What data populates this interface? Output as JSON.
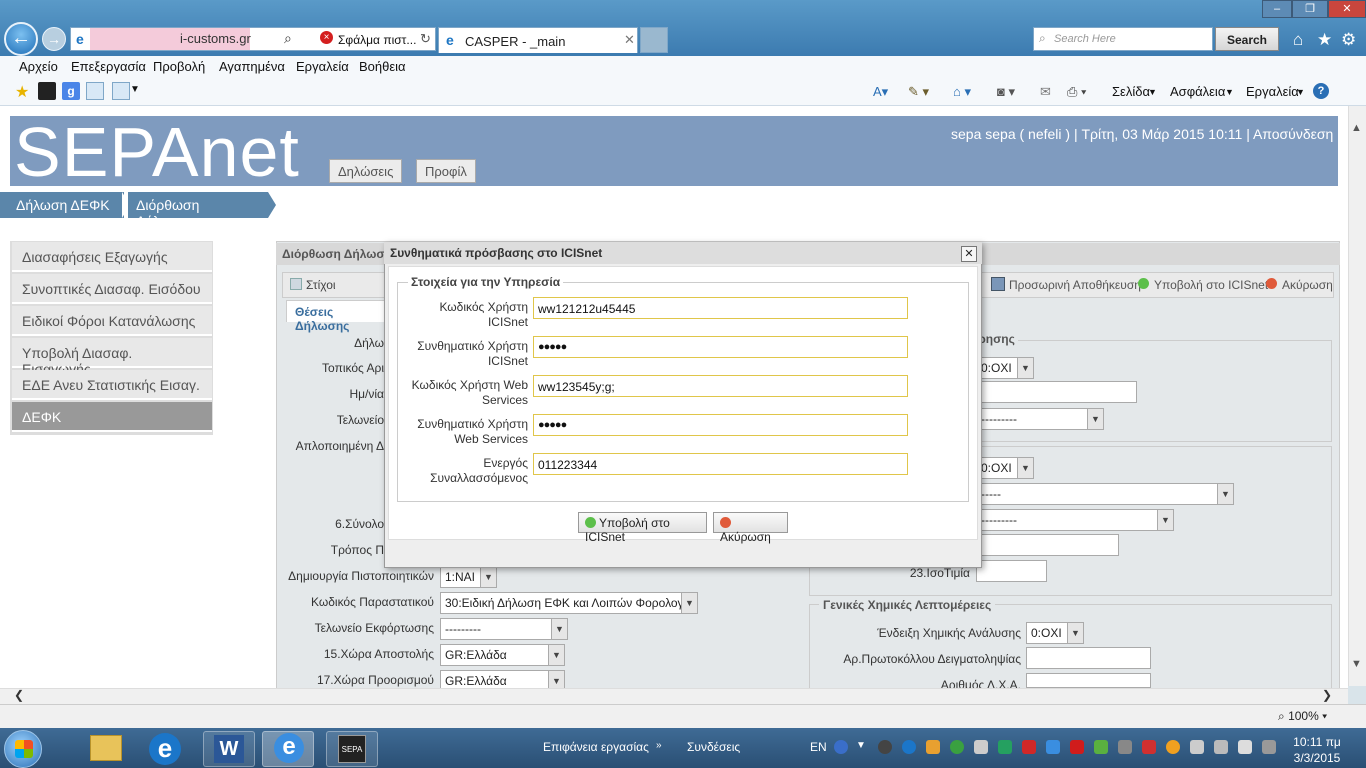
{
  "browser": {
    "address": "i-customs.gr",
    "error_tab": "Σφάλμα πιστ...",
    "tab_title": "CASPER - _main",
    "search_placeholder": "Search Here",
    "search_button": "Search",
    "menu": [
      "Αρχείο",
      "Επεξεργασία",
      "Προβολή",
      "Αγαπημένα",
      "Εργαλεία",
      "Βοήθεια"
    ],
    "toolbar": [
      "Σελίδα",
      "Ασφάλεια",
      "Εργαλεία"
    ],
    "zoom": "100%"
  },
  "app": {
    "logo": "SEPAnet",
    "header_tabs": [
      "Δηλώσεις",
      "Προφίλ"
    ],
    "user_line": "sepa sepa ( nefeli ) | Τρίτη, 03 Μάρ 2015 10:11 | Αποσύνδεση",
    "breadcrumb": [
      "Δήλωση ΔΕΦΚ",
      "Διόρθωση Δήλωσης"
    ],
    "sidebar": [
      "Διασαφήσεις Εξαγωγής",
      "Συνοπτικές Διασαφ. Εισόδου",
      "Ειδικοί Φόροι Κατανάλωσης",
      "Υποβολή Διασαφ. Εισαγωγής",
      "ΕΔΕ Ανευ Στατιστικής Εισαγ.",
      "ΔΕΦΚ"
    ]
  },
  "panel": {
    "title": "Διόρθωση Δήλωσ",
    "tab_stixoi": "Στίχοι",
    "tab_theseis": "Θέσεις Δήλωσης",
    "save_temp": "Προσωρινή Αποθήκευση",
    "submit": "Υποβολή στο ICISnet",
    "cancel": "Ακύρωση",
    "section_right": "όρησης",
    "labels_left": [
      "Δήλω",
      "Τοπικός Αρι",
      "Ημ/νία",
      "Τελωνείο",
      "Απλοποιημένη Δ",
      "6.Σύνολο",
      "Τρόπος Π"
    ],
    "fields": {
      "pistop_label": "Δημιουργία Πιστοποιητικών",
      "pistop_value": "1:ΝΑΙ",
      "parast_label": "Κωδικός Παραστατικού",
      "parast_value": "30:Ειδική Δήλωση ΕΦΚ και Λοιπών Φορολογι",
      "telon_label": "Τελωνείο Εκφόρτωσης",
      "telon_value": "---------",
      "xora_apost_label": "15.Χώρα Αποστολής",
      "xora_apost_value": "GR:Ελλάδα",
      "xora_proor_label": "17.Χώρα Προορισμού",
      "xora_proor_value": "GR:Ελλάδα",
      "r1": "0:ΟΧΙ",
      "r2": "---------",
      "r3": "0:ΟΧΙ",
      "r4": "-----",
      "r5": "---------",
      "r6_label": "23.ΙσοΤιμία"
    },
    "chem": {
      "legend": "Γενικές Χημικές Λεπτομέρειες",
      "analysis_label": "Ένδειξη Χημικής Ανάλυσης",
      "analysis_value": "0:ΟΧΙ",
      "protocol_label": "Αρ.Πρωτοκόλλου Δειγματοληψίας",
      "dxa_label": "Αριθμός Δ.Χ.Α."
    }
  },
  "dialog": {
    "title": "Συνθηματικά πρόσβασης στο ICISnet",
    "legend": "Στοιχεία για την Υπηρεσία",
    "rows": [
      {
        "label": "Κωδικός Χρήστη ICISnet",
        "value": "ww121212u45445"
      },
      {
        "label": "Συνθηματικό Χρήστη ICISnet",
        "value": "●●●●●"
      },
      {
        "label": "Κωδικός Χρήστη Web Services",
        "value": "ww123545y;g;"
      },
      {
        "label": "Συνθηματικό Χρήστη Web Services",
        "value": "●●●●●"
      },
      {
        "label": "Ενεργός Συναλλασσόμενος",
        "value": "011223344"
      }
    ],
    "submit": "Υποβολή στο ICISnet",
    "cancel": "Ακύρωση"
  },
  "taskbar": {
    "desktop": "Επιφάνεια εργασίας",
    "connections": "Συνδέσεις",
    "lang": "EN",
    "time": "10:11 πμ",
    "date": "3/3/2015",
    "sepa_app": "SEPA"
  }
}
